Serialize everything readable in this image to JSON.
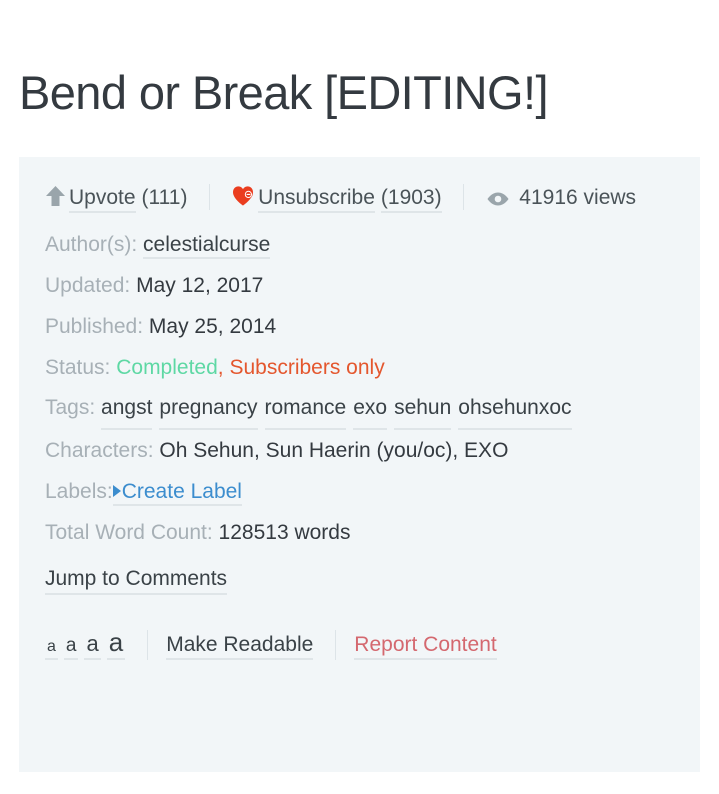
{
  "page": {
    "title": "Bend or Break [EDITING!]"
  },
  "stats": {
    "upvote": {
      "icon": "upvote-arrow-icon",
      "label": "Upvote",
      "count": "(111)"
    },
    "subscribe": {
      "icon": "heart-minus-icon",
      "label": "Unsubscribe",
      "count": "(1903)"
    },
    "views": {
      "icon": "eye-icon",
      "count": "41916",
      "suffix": "views"
    }
  },
  "meta": {
    "authors": {
      "label": "Author(s):",
      "value": "celestialcurse"
    },
    "updated": {
      "label": "Updated:",
      "value": "May 12, 2017"
    },
    "published": {
      "label": "Published:",
      "value": "May 25, 2014"
    },
    "status": {
      "label": "Status:",
      "completed": "Completed",
      "separator": ",",
      "subscribers_only": "Subscribers only"
    },
    "tags": {
      "label": "Tags:",
      "items": [
        "angst",
        "pregnancy",
        "romance",
        "exo",
        "sehun",
        "ohsehunxoc"
      ]
    },
    "characters": {
      "label": "Characters:",
      "value": "Oh Sehun, Sun Haerin (you/oc), EXO"
    },
    "labels": {
      "label": "Labels:",
      "create_label": "Create Label"
    },
    "word_count": {
      "label": "Total Word Count:",
      "value": "128513 words"
    },
    "jump_to_comments": "Jump to Comments"
  },
  "toolbar": {
    "font_sizes": [
      "a",
      "a",
      "a",
      "a"
    ],
    "make_readable": "Make Readable",
    "report_content": "Report Content"
  },
  "colors": {
    "panel_bg": "#f2f6f8",
    "title": "#343a40",
    "label_gray": "#a7b0b6",
    "value_dark": "#343a40",
    "status_completed": "#5ed8a4",
    "status_subscribers_only": "#e4572e",
    "link_blue": "#3c8dce",
    "report_red": "#d4686f",
    "heart_red": "#ea3d1f",
    "icon_gray": "#9aa5ab",
    "underline": "#dfe5e8"
  }
}
